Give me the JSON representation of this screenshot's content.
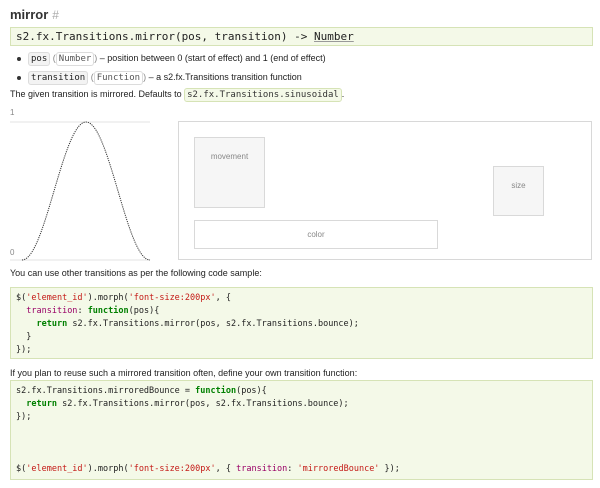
{
  "heading": {
    "title": "mirror",
    "anchor": "#"
  },
  "signature": {
    "text": "s2.fx.Transitions.mirror(pos, transition) -> ",
    "return_type": "Number"
  },
  "params": [
    {
      "name": "pos",
      "type": "Number",
      "desc": " – position between 0 (start of effect) and 1 (end of effect)"
    },
    {
      "name": "transition",
      "type": "Function",
      "desc": " – a s2.fx.Transitions transition function"
    }
  ],
  "description": {
    "before": "The given transition is mirrored. Defaults to ",
    "code": "s2.fx.Transitions.sinusoidal",
    "after": "."
  },
  "curve": {
    "label_top": "1",
    "label_bottom": "0"
  },
  "demo": {
    "movement": "movement",
    "size": "size",
    "color": "color"
  },
  "intro_code1": "You can use other transitions as per the following code sample:",
  "code1": {
    "l1a": "$(",
    "l1b": "'element_id'",
    "l1c": ").morph(",
    "l1d": "'font-size:200px'",
    "l1e": ", {",
    "l2a": "  ",
    "l2b": "transition",
    "l2c": ": ",
    "l2d": "function",
    "l2e": "(pos){",
    "l3a": "    ",
    "l3b": "return",
    "l3c": " s2.fx.Transitions.mirror(pos, s2.fx.Transitions.bounce);",
    "l4": "  }",
    "l5": "});"
  },
  "intro_code2": "If you plan to reuse such a mirrored transition often, define your own transition function:",
  "code2": {
    "l1a": "s2.fx.Transitions.mirroredBounce = ",
    "l1b": "function",
    "l1c": "(pos){",
    "l2a": "  ",
    "l2b": "return",
    "l2c": " s2.fx.Transitions.mirror(pos, s2.fx.Transitions.bounce);",
    "l3": "});",
    "l7a": "$(",
    "l7b": "'element_id'",
    "l7c": ").morph(",
    "l7d": "'font-size:200px'",
    "l7e": ", { ",
    "l7f": "transition",
    "l7g": ": ",
    "l7h": "'mirroredBounce'",
    "l7i": " });"
  }
}
